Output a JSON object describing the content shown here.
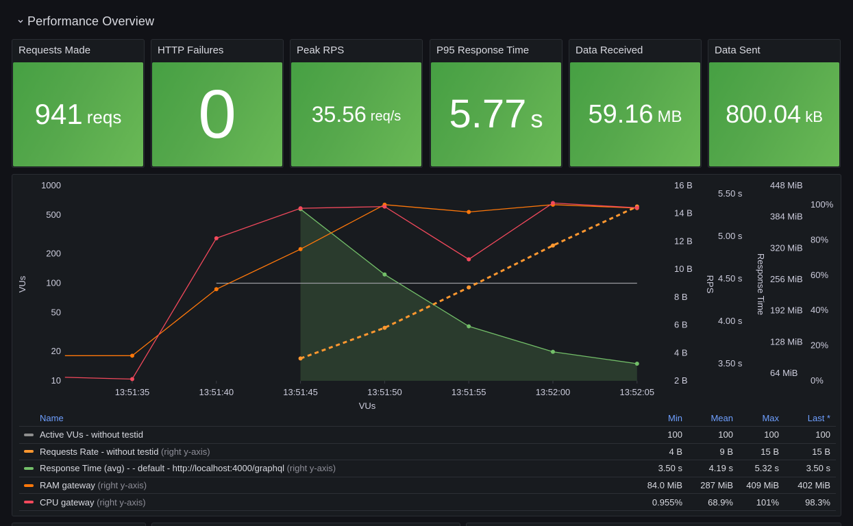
{
  "row": {
    "title": "Performance Overview",
    "collapse_icon": "chevron-down-icon"
  },
  "stats": [
    {
      "title": "Requests Made",
      "value": "941",
      "unit": "reqs"
    },
    {
      "title": "HTTP Failures",
      "value": "0",
      "unit": ""
    },
    {
      "title": "Peak RPS",
      "value": "35.56",
      "unit": "req/s"
    },
    {
      "title": "P95 Response Time",
      "value": "5.77",
      "unit": "s"
    },
    {
      "title": "Data Received",
      "value": "59.16",
      "unit": "MB"
    },
    {
      "title": "Data Sent",
      "value": "800.04",
      "unit": "kB"
    }
  ],
  "colors": {
    "stat_green": "#56a84c",
    "vus": "#8e8e8e",
    "requests_rate": "#ff9830",
    "response_time": "#73bf69",
    "ram": "#ff780a",
    "cpu": "#f2495c",
    "legend_header": "#6e9fff"
  },
  "chart_data": {
    "type": "line",
    "x": [
      "13:51:35",
      "13:51:40",
      "13:51:45",
      "13:51:50",
      "13:51:55",
      "13:52:00",
      "13:52:05"
    ],
    "xlabel": "VUs",
    "axes": {
      "left": {
        "label": "VUs",
        "scale": "log",
        "ticks": [
          "1000",
          "500",
          "200",
          "100",
          "50",
          "20",
          "10"
        ],
        "range": [
          10,
          1000
        ]
      },
      "right_rps": {
        "label": "RPS",
        "ticks": [
          "16 B",
          "14 B",
          "12 B",
          "10 B",
          "8 B",
          "6 B",
          "4 B",
          "2 B"
        ],
        "range": [
          2,
          16
        ]
      },
      "right_response": {
        "label": "Response Time",
        "ticks": [
          "5.50 s",
          "5.00 s",
          "4.50 s",
          "4.00 s",
          "3.50 s"
        ],
        "range": [
          3.4,
          5.6
        ]
      },
      "right_ram": {
        "label": "",
        "ticks": [
          "448 MiB",
          "384 MiB",
          "320 MiB",
          "256 MiB",
          "192 MiB",
          "128 MiB",
          "64 MiB"
        ],
        "range": [
          50,
          448
        ]
      },
      "right_cpu": {
        "label": "",
        "ticks": [
          "100%",
          "80%",
          "60%",
          "40%",
          "20%",
          "0%"
        ],
        "range": [
          0,
          111
        ]
      }
    },
    "series": [
      {
        "name": "Active VUs - without testid",
        "axis": "left",
        "style": "solid",
        "points": false,
        "x": [
          "13:51:40",
          "13:52:05"
        ],
        "values": [
          100,
          100
        ]
      },
      {
        "name": "Requests Rate - without testid",
        "axis": "right_rps",
        "style": "dashed",
        "x": [
          "13:51:45",
          "13:51:50",
          "13:51:55",
          "13:52:00",
          "13:52:05"
        ],
        "values": [
          3.6,
          5.8,
          8.7,
          11.7,
          14.5
        ]
      },
      {
        "name": "Response Time (avg) - - default - http://localhost:4000/graphql",
        "axis": "right_response",
        "style": "area",
        "x": [
          "13:51:45",
          "13:51:50",
          "13:51:55",
          "13:52:00",
          "13:52:05"
        ],
        "values": [
          5.32,
          4.55,
          3.94,
          3.64,
          3.5
        ]
      },
      {
        "name": "RAM gateway",
        "axis": "right_ram",
        "style": "solid",
        "x": [
          "13:51:31",
          "13:51:35",
          "13:51:40",
          "13:51:45",
          "13:51:50",
          "13:51:55",
          "13:52:00",
          "13:52:05"
        ],
        "values": [
          100,
          100,
          236,
          318,
          409,
          394,
          409,
          402
        ]
      },
      {
        "name": "CPU gateway",
        "axis": "right_cpu",
        "style": "solid",
        "x": [
          "13:51:31",
          "13:51:35",
          "13:51:40",
          "13:51:45",
          "13:51:50",
          "13:51:55",
          "13:52:00",
          "13:52:05"
        ],
        "values": [
          2.0,
          0.955,
          81,
          98,
          99,
          69,
          101,
          98.3
        ]
      }
    ]
  },
  "legend": {
    "headers": {
      "name": "Name",
      "min": "Min",
      "mean": "Mean",
      "max": "Max",
      "last": "Last *"
    },
    "rows": [
      {
        "name": "Active VUs - without testid",
        "hint": "",
        "color_key": "vus",
        "min": "100",
        "mean": "100",
        "max": "100",
        "last": "100"
      },
      {
        "name": "Requests Rate - without testid",
        "hint": "(right y-axis)",
        "color_key": "requests_rate",
        "min": "4 B",
        "mean": "9 B",
        "max": "15 B",
        "last": "15 B"
      },
      {
        "name": "Response Time (avg) - - default - http://localhost:4000/graphql",
        "hint": "(right y-axis)",
        "color_key": "response_time",
        "min": "3.50 s",
        "mean": "4.19 s",
        "max": "5.32 s",
        "last": "3.50 s"
      },
      {
        "name": "RAM gateway",
        "hint": "(right y-axis)",
        "color_key": "ram",
        "min": "84.0 MiB",
        "mean": "287 MiB",
        "max": "409 MiB",
        "last": "402 MiB"
      },
      {
        "name": "CPU gateway",
        "hint": "(right y-axis)",
        "color_key": "cpu",
        "min": "0.955%",
        "mean": "68.9%",
        "max": "101%",
        "last": "98.3%"
      }
    ]
  }
}
